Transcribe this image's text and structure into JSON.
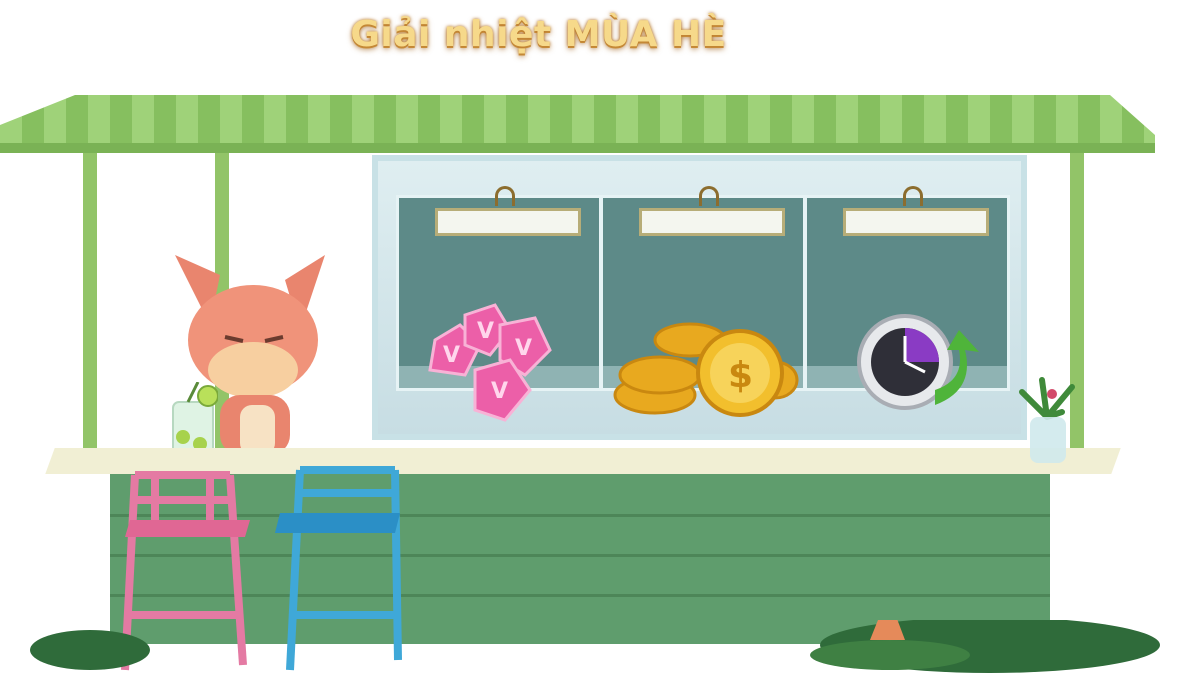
{
  "title": "Giải nhiệt MÙA HÈ",
  "shop": {
    "slots": [
      {
        "item": "v-gems",
        "sign": ""
      },
      {
        "item": "gold-coins",
        "sign": ""
      },
      {
        "item": "time-boost-clock",
        "sign": ""
      }
    ]
  },
  "colors": {
    "awning_green": "#8cc466",
    "counter_green": "#5f9d6d",
    "title_gold": "#f6d98a",
    "fox_orange": "#e9856e",
    "gem_pink": "#ec5fa8",
    "coin_gold": "#f2bf2d",
    "clock_purple": "#8a3bc4"
  }
}
